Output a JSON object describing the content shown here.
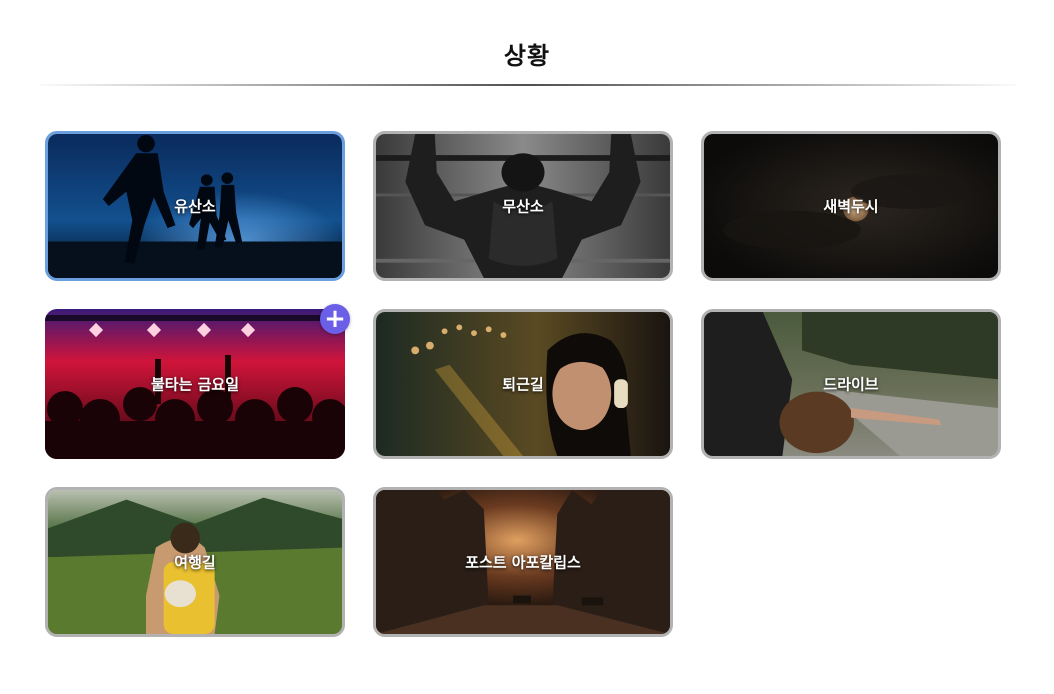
{
  "header": {
    "title": "상황"
  },
  "cards": [
    {
      "label": "유산소",
      "image": "silhouette-runners-at-dusk"
    },
    {
      "label": "무산소",
      "image": "muscular-back-pull-up-bw"
    },
    {
      "label": "새벽두시",
      "image": "moon-in-dark-clouds"
    },
    {
      "label": "불타는 금요일",
      "image": "concert-crowd-red-lights"
    },
    {
      "label": "퇴근길",
      "image": "woman-with-headphones-city-lights"
    },
    {
      "label": "드라이브",
      "image": "woman-leaning-out-car-window"
    },
    {
      "label": "여행길",
      "image": "hiker-with-backpack-in-valley"
    },
    {
      "label": "포스트 아포칼립스",
      "image": "ruined-city-street"
    }
  ],
  "add_button": {
    "icon": "plus-icon",
    "glyph": "+"
  },
  "colors": {
    "active_border": "#6aa0e0",
    "card_border": "#b2b2b2",
    "add_button": "#6b5fe8"
  }
}
